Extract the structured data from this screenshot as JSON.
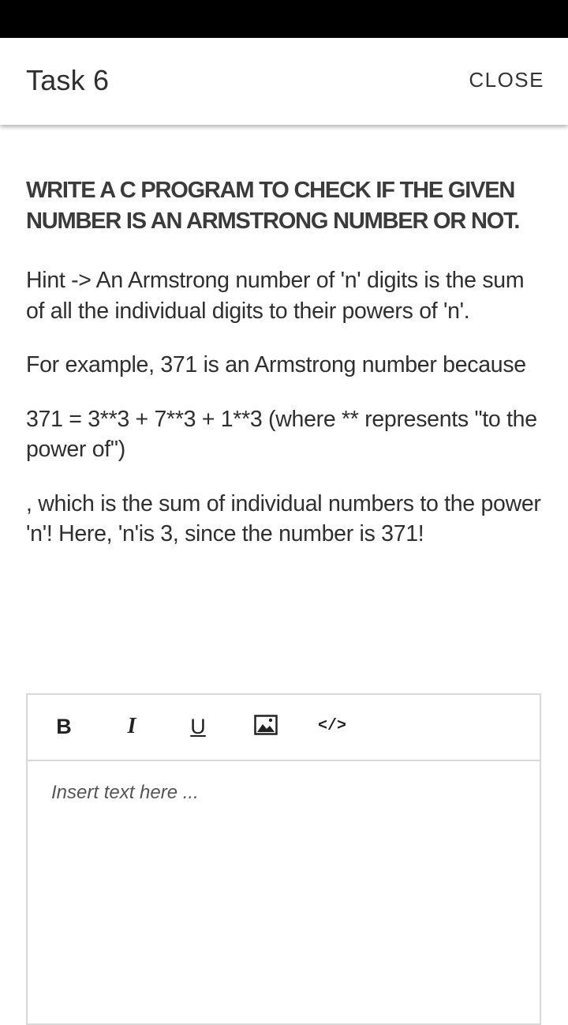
{
  "app_bar": {
    "title": "Task 6",
    "close_label": "CLOSE"
  },
  "task": {
    "heading": "WRITE A C PROGRAM TO CHECK IF THE GIVEN NUMBER IS AN ARMSTRONG NUMBER OR NOT.",
    "paragraphs": [
      "Hint -> An Armstrong number of 'n' digits is the sum of all the individual digits to their powers of 'n'.",
      "For example, 371 is an Armstrong number because",
      "371 = 3**3 + 7**3 + 1**3 (where ** represents \"to the power of\")",
      ", which is the sum of individual numbers to the power 'n'! Here, 'n'is 3, since the number is 371!"
    ]
  },
  "editor": {
    "toolbar": {
      "bold_label": "B",
      "italic_label": "I",
      "underline_label": "U",
      "image_icon": "image-icon",
      "code_label": "</>"
    },
    "placeholder": "Insert text here ..."
  },
  "colors": {
    "status_bar": "#000000",
    "background": "#ffffff",
    "text": "#2f2f2f",
    "border": "#d9d9d9"
  }
}
